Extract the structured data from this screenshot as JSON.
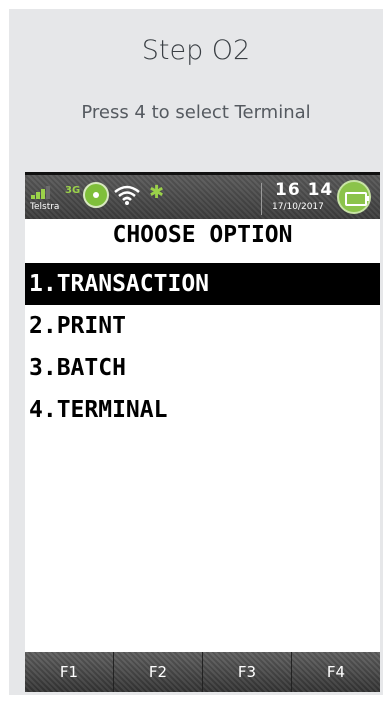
{
  "step": {
    "title": "Step O2",
    "subtitle": "Press 4 to select Terminal"
  },
  "status_bar": {
    "network": "3G",
    "carrier": "Telstra",
    "time": "16 14",
    "date": "17/10/2017",
    "icons": [
      "signal-icon",
      "globe-icon",
      "wifi-icon",
      "bluetooth-icon",
      "battery-icon"
    ]
  },
  "screen": {
    "title": "CHOOSE OPTION",
    "items": [
      {
        "label": "1.TRANSACTION",
        "selected": true
      },
      {
        "label": "2.PRINT",
        "selected": false
      },
      {
        "label": "3.BATCH",
        "selected": false
      },
      {
        "label": "4.TERMINAL",
        "selected": false
      }
    ]
  },
  "function_keys": [
    "F1",
    "F2",
    "F3",
    "F4"
  ],
  "colors": {
    "card_bg": "#e6e7e9",
    "status_accent": "#9bd24a",
    "selected_bg": "#000000",
    "selected_fg": "#ffffff"
  }
}
